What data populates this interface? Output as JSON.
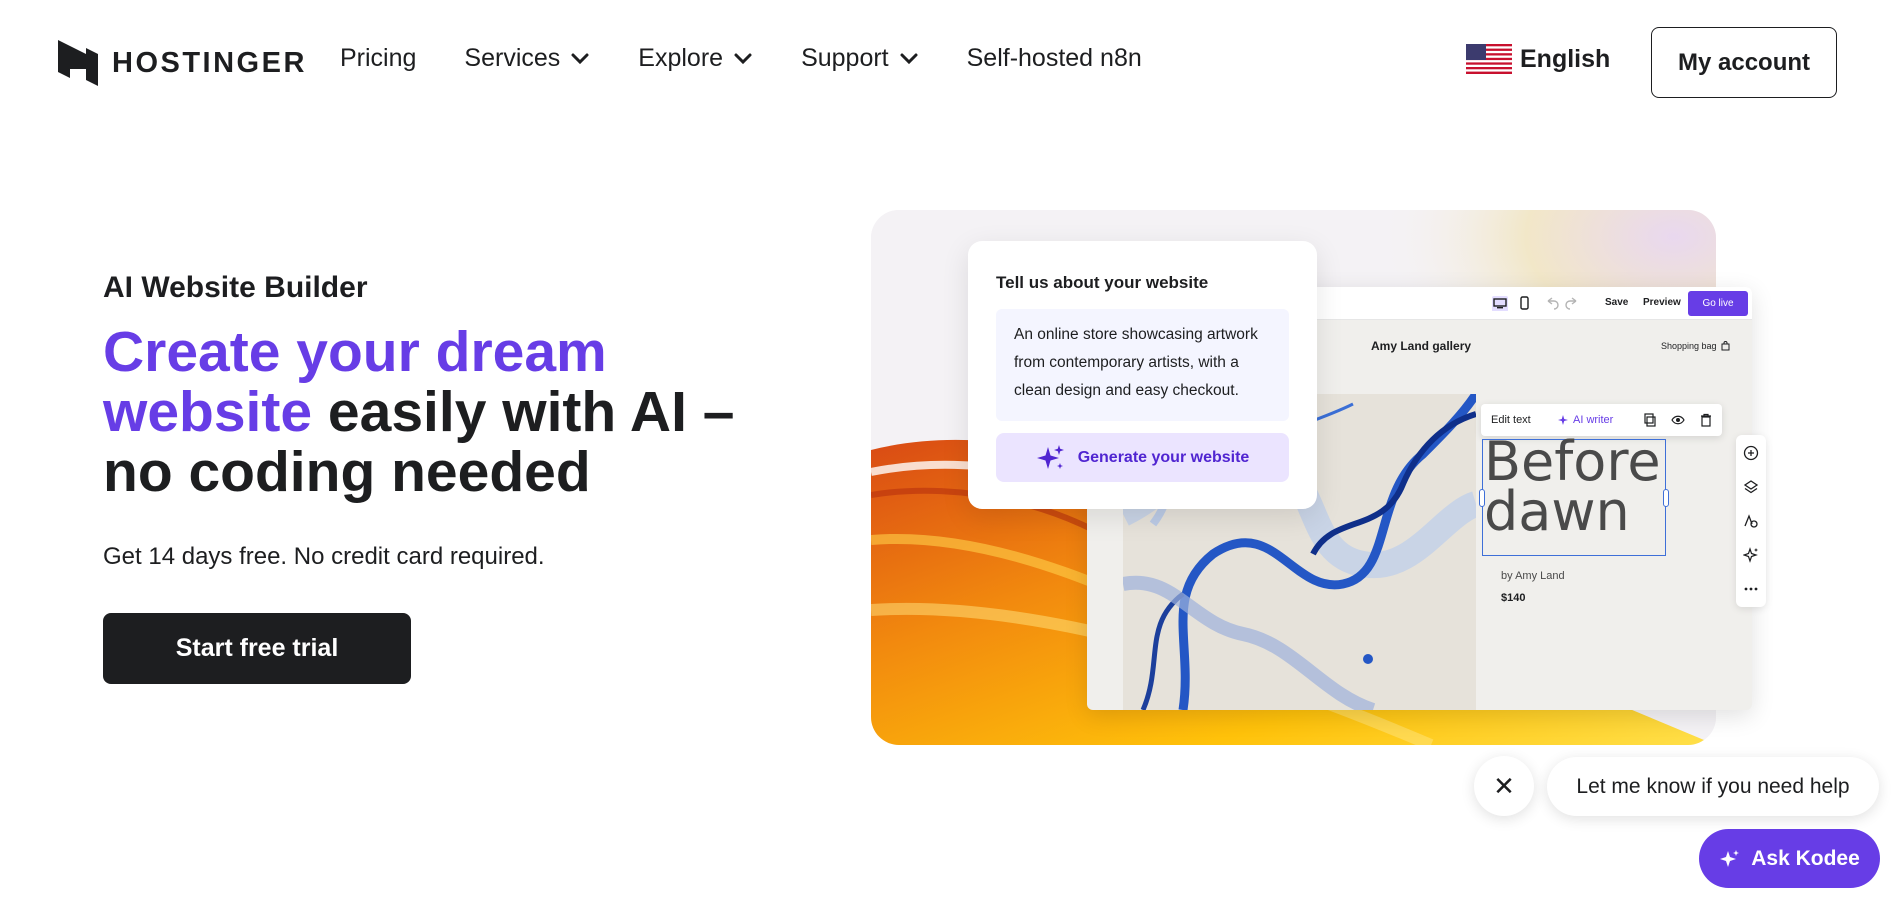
{
  "brand": {
    "name": "HOSTINGER"
  },
  "nav": {
    "items": [
      {
        "label": "Pricing",
        "has_dropdown": false
      },
      {
        "label": "Services",
        "has_dropdown": true
      },
      {
        "label": "Explore",
        "has_dropdown": true
      },
      {
        "label": "Support",
        "has_dropdown": true
      },
      {
        "label": "Self-hosted n8n",
        "has_dropdown": false
      }
    ],
    "language": "English",
    "account_button": "My account"
  },
  "hero": {
    "eyebrow": "AI Website Builder",
    "headline_accent": "Create your dream website",
    "headline_rest": " easily with AI – no coding needed",
    "subtitle": "Get 14 days free. No credit card required.",
    "cta": "Start free trial"
  },
  "mockup": {
    "prompt_card": {
      "title": "Tell us about your website",
      "text": "An online store showcasing artwork from contemporary artists, with a clean design and easy checkout.",
      "button": "Generate your website"
    },
    "editor": {
      "save": "Save",
      "preview": "Preview",
      "go_live": "Go live",
      "site_title": "Amy Land gallery",
      "shopping_bag": "Shopping bag",
      "edit_text": "Edit text",
      "ai_writer": "AI writer",
      "artwork_title": "Before dawn",
      "byline": "by Amy Land",
      "price": "$140"
    }
  },
  "chat": {
    "close": "✕",
    "message": "Let me know if you need help",
    "button": "Ask Kodee"
  },
  "colors": {
    "accent": "#673de6",
    "text": "#1d1e20",
    "cta_bg": "#1d1e20"
  }
}
